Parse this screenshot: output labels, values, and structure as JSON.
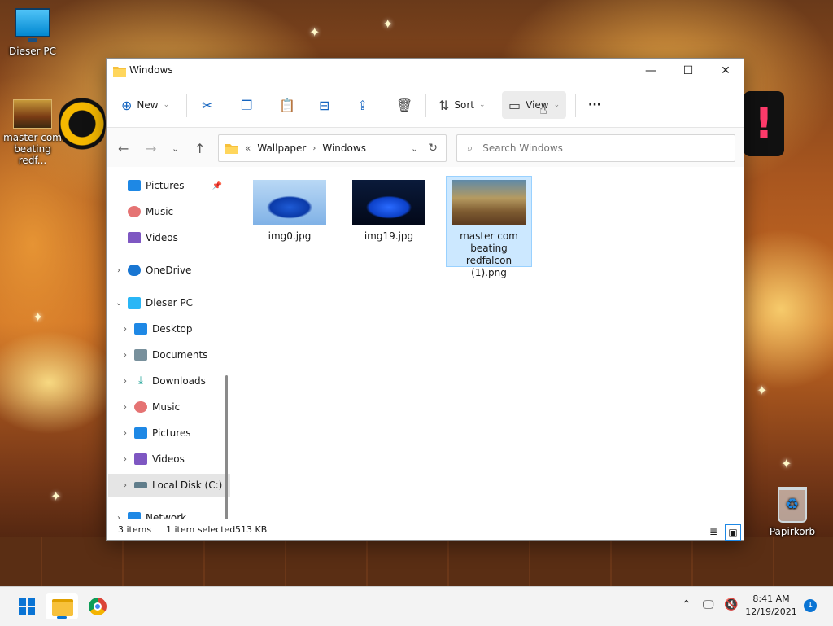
{
  "desktop": {
    "icons": [
      {
        "label": "Dieser PC"
      },
      {
        "label": "master com beating redf..."
      },
      {
        "label": "Papirkorb"
      }
    ]
  },
  "window": {
    "title": "Windows",
    "controls": {
      "minimize": "—",
      "maximize": "☐",
      "close": "✕"
    }
  },
  "toolbar": {
    "new_label": "New",
    "sort_label": "Sort",
    "view_label": "View",
    "more_label": "···",
    "icons": [
      "new-icon",
      "cut-icon",
      "copy-icon",
      "paste-icon",
      "rename-icon",
      "share-icon",
      "delete-icon",
      "sort-icon",
      "view-icon",
      "more-icon"
    ]
  },
  "address": {
    "overflow": "«",
    "segments": [
      "Wallpaper",
      "Windows"
    ],
    "search_placeholder": "Search Windows"
  },
  "navpane": {
    "items": [
      {
        "label": "Pictures",
        "pinned": true,
        "indent": 1,
        "color": "#1e88e5"
      },
      {
        "label": "Music",
        "indent": 1,
        "color": "#e57373"
      },
      {
        "label": "Videos",
        "indent": 1,
        "color": "#7e57c2"
      },
      {
        "label": "OneDrive",
        "indent": 0,
        "expandable": true,
        "color": "#1976d2"
      },
      {
        "label": "Dieser PC",
        "indent": 0,
        "expanded": true,
        "color": "#29b6f6"
      },
      {
        "label": "Desktop",
        "indent": 1,
        "expandable": true,
        "color": "#1e88e5"
      },
      {
        "label": "Documents",
        "indent": 1,
        "expandable": true,
        "color": "#78909c"
      },
      {
        "label": "Downloads",
        "indent": 1,
        "expandable": true,
        "color": "#26a69a"
      },
      {
        "label": "Music",
        "indent": 1,
        "expandable": true,
        "color": "#e57373"
      },
      {
        "label": "Pictures",
        "indent": 1,
        "expandable": true,
        "color": "#1e88e5"
      },
      {
        "label": "Videos",
        "indent": 1,
        "expandable": true,
        "color": "#7e57c2"
      },
      {
        "label": "Local Disk (C:)",
        "indent": 1,
        "expandable": true,
        "selected": true,
        "color": "#607d8b"
      },
      {
        "label": "Network",
        "indent": 0,
        "expandable": true,
        "color": "#1e88e5"
      }
    ]
  },
  "files": [
    {
      "name": "img0.jpg",
      "selected": false
    },
    {
      "name": "img19.jpg",
      "selected": false
    },
    {
      "name": "master com beating redfalcon (1).png",
      "selected": true
    }
  ],
  "status": {
    "items_count": "3 items",
    "selection": "1 item selected",
    "size": "513 KB"
  },
  "taskbar": {
    "time": "8:41 AM",
    "date": "12/19/2021",
    "notifications": "1"
  }
}
